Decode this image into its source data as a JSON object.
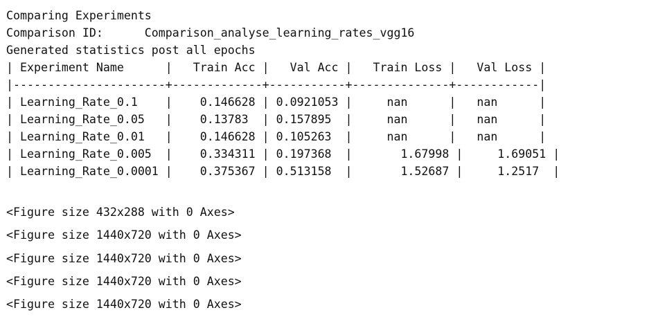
{
  "output": {
    "header_lines": [
      "Comparing Experiments",
      "Comparison ID:      Comparison_analyse_learning_rates_vgg16",
      "Generated statistics post all epochs"
    ],
    "table": {
      "columns": [
        "Experiment Name",
        "Train Acc",
        "Val Acc",
        "Train Loss",
        "Val Loss"
      ],
      "rows": [
        [
          "Learning_Rate_0.1",
          "0.146628",
          "0.0921053",
          "nan",
          "nan"
        ],
        [
          "Learning_Rate_0.05",
          "0.13783",
          "0.157895",
          "nan",
          "nan"
        ],
        [
          "Learning_Rate_0.01",
          "0.146628",
          "0.105263",
          "nan",
          "nan"
        ],
        [
          "Learning_Rate_0.005",
          "0.334311",
          "0.197368",
          "1.67998",
          "1.69051"
        ],
        [
          "Learning_Rate_0.0001",
          "0.375367",
          "0.513158",
          "1.52687",
          "1.2517"
        ]
      ],
      "lines": [
        "| Experiment Name      |   Train Acc |   Val Acc |   Train Loss |   Val Loss |",
        "|----------------------+-------------+-----------+--------------+------------|",
        "| Learning_Rate_0.1    |    0.146628 | 0.0921053 |     nan      |   nan      |",
        "| Learning_Rate_0.05   |    0.13783  | 0.157895  |     nan      |   nan      |",
        "| Learning_Rate_0.01   |    0.146628 | 0.105263  |     nan      |   nan      |",
        "| Learning_Rate_0.005  |    0.334311 | 0.197368  |       1.67998 |     1.69051 |",
        "| Learning_Rate_0.0001 |    0.375367 | 0.513158  |       1.52687 |     1.2517  |"
      ]
    },
    "figure_lines": [
      "<Figure size 432x288 with 0 Axes>",
      "<Figure size 1440x720 with 0 Axes>",
      "<Figure size 1440x720 with 0 Axes>",
      "<Figure size 1440x720 with 0 Axes>",
      "<Figure size 1440x720 with 0 Axes>"
    ]
  }
}
